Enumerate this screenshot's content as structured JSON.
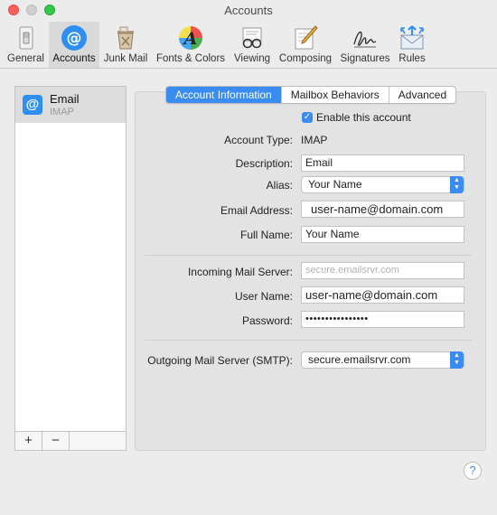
{
  "window": {
    "title": "Accounts"
  },
  "toolbar": {
    "items": [
      {
        "label": "General",
        "icon": "general-switch-icon"
      },
      {
        "label": "Accounts",
        "icon": "at-sign-icon",
        "active": true
      },
      {
        "label": "Junk Mail",
        "icon": "trash-bin-icon"
      },
      {
        "label": "Fonts & Colors",
        "icon": "font-palette-icon"
      },
      {
        "label": "Viewing",
        "icon": "glasses-icon"
      },
      {
        "label": "Composing",
        "icon": "pen-paper-icon"
      },
      {
        "label": "Signatures",
        "icon": "signature-icon"
      },
      {
        "label": "Rules",
        "icon": "rules-envelope-icon"
      }
    ]
  },
  "accounts": {
    "items": [
      {
        "name": "Email",
        "type": "IMAP"
      }
    ],
    "add_label": "+",
    "remove_label": "−"
  },
  "tabs": {
    "account_info": "Account Information",
    "mailbox_behaviors": "Mailbox Behaviors",
    "advanced": "Advanced",
    "selected": "Account Information"
  },
  "form": {
    "enable_label": "Enable this account",
    "enable_checked": true,
    "account_type_label": "Account Type:",
    "account_type_value": "IMAP",
    "description_label": "Description:",
    "description_value": "Email",
    "alias_label": "Alias:",
    "alias_value": "Your Name",
    "email_label": "Email Address:",
    "email_value": "user-name@domain.com",
    "fullname_label": "Full Name:",
    "fullname_value": "Your Name",
    "incoming_label": "Incoming Mail Server:",
    "incoming_placeholder": "secure.emailsrvr.com",
    "username_label": "User Name:",
    "username_value": "user-name@domain.com",
    "password_label": "Password:",
    "password_value": "••••••••••••••••",
    "outgoing_label": "Outgoing Mail Server (SMTP):",
    "outgoing_value": "secure.emailsrvr.com"
  },
  "help": {
    "label": "?"
  },
  "colors": {
    "accent": "#3b8cf0",
    "close": "#fc605c",
    "zoom": "#34c84a"
  }
}
